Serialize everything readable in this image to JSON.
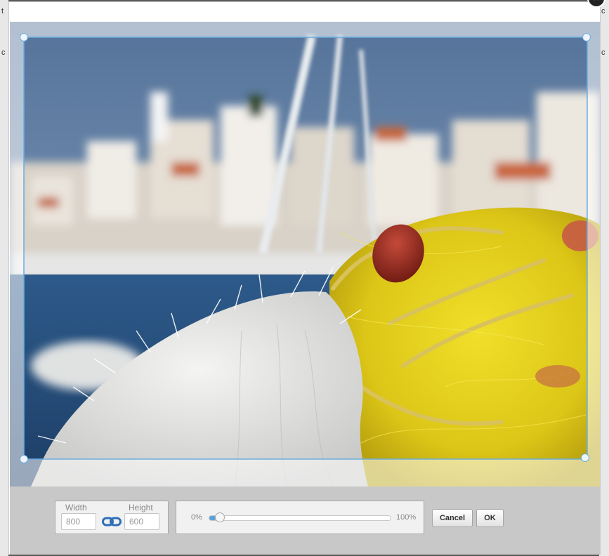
{
  "dialog": {
    "close_glyph": "×",
    "image_alt": "Yellow fishing nets in front of a harbor town"
  },
  "backdrop": {
    "left_glyphs": [
      "t",
      "c"
    ],
    "right_glyphs": [
      "c",
      "c"
    ]
  },
  "resize": {
    "width_label": "Width",
    "height_label": "Height",
    "width_value": "800",
    "height_value": "600",
    "lock_icon": "link-icon"
  },
  "zoom": {
    "min_label": "0%",
    "max_label": "100%",
    "value_percent": 4
  },
  "buttons": {
    "cancel": "Cancel",
    "ok": "OK"
  },
  "colors": {
    "accent": "#5aa0d8",
    "crop_border": "#6aaee0",
    "toolbar_bg": "#c8c8c8"
  }
}
